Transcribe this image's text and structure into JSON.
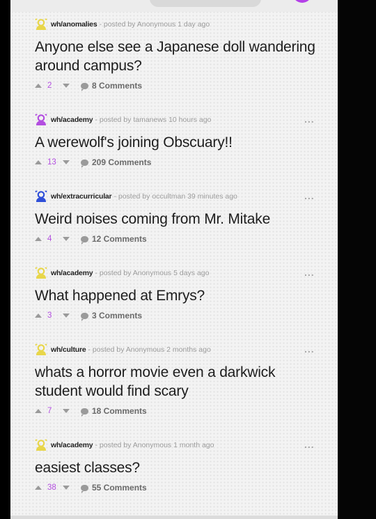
{
  "colors": {
    "accent": "#b34ee0",
    "avatar_yellow": "#e8d64a",
    "avatar_purple": "#b34ee0",
    "avatar_blue": "#2f4fd8"
  },
  "posts": [
    {
      "channel": "wh/anomalies",
      "posted_by": "- posted by Anonymous 1 day ago",
      "title": "Anyone else see a Japanese doll wandering around campus?",
      "votes": "2",
      "comments": "8 Comments",
      "avatar_color": "yellow",
      "show_more": false
    },
    {
      "channel": "wh/academy",
      "posted_by": "- posted by tamanews 10 hours ago",
      "title": "A werewolf's joining Obscuary!!",
      "votes": "13",
      "comments": "209 Comments",
      "avatar_color": "purple",
      "show_more": true
    },
    {
      "channel": "wh/extracurricular",
      "posted_by": "- posted by occultman 39 minutes ago",
      "title": "Weird noises coming from Mr. Mitake",
      "votes": "4",
      "comments": "12 Comments",
      "avatar_color": "blue",
      "show_more": true
    },
    {
      "channel": "wh/academy",
      "posted_by": "- posted by Anonymous 5 days ago",
      "title": "What happened at Emrys?",
      "votes": "3",
      "comments": "3 Comments",
      "avatar_color": "yellow",
      "show_more": true
    },
    {
      "channel": "wh/culture",
      "posted_by": "- posted by Anonymous 2 months ago",
      "title": "whats a horror movie even a darkwick student would find scary",
      "votes": "7",
      "comments": "18 Comments",
      "avatar_color": "yellow",
      "show_more": true
    },
    {
      "channel": "wh/academy",
      "posted_by": "- posted by Anonymous 1 month ago",
      "title": "easiest classes?",
      "votes": "38",
      "comments": "55 Comments",
      "avatar_color": "yellow",
      "show_more": true
    }
  ],
  "more_label": "..."
}
